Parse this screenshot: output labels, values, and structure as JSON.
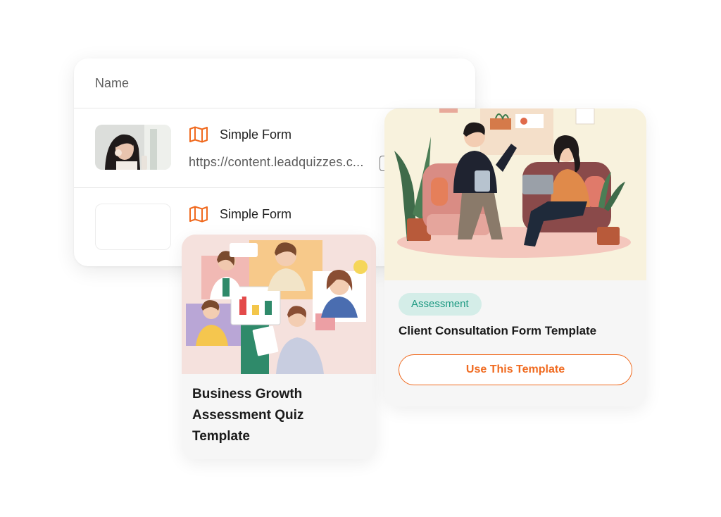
{
  "table": {
    "header": "Name",
    "rows": [
      {
        "type": "Simple Form",
        "url": "https://content.leadquizzes.c...",
        "icon": "map-icon"
      },
      {
        "type": "Simple Form",
        "icon": "map-icon"
      }
    ]
  },
  "templates": [
    {
      "title": "Business Growth Assessment Quiz Template"
    },
    {
      "badge": "Assessment",
      "title": "Client Consultation Form Template",
      "button": "Use This Template"
    }
  ],
  "colors": {
    "accent": "#f06a1f",
    "badge_bg": "#d4ede8",
    "badge_text": "#1f9a83"
  }
}
